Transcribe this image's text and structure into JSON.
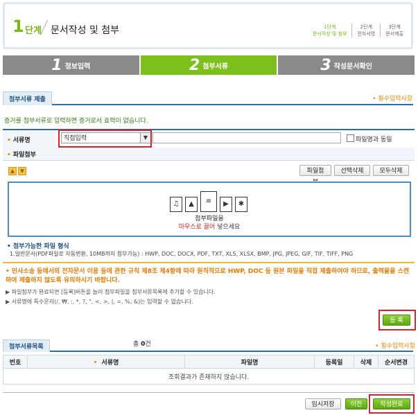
{
  "step_header": {
    "number": "1",
    "word": "단계",
    "title": "문서작성 및 첨부",
    "mini_steps": [
      {
        "label": "1단계",
        "sub": "문서작성 및 첨부"
      },
      {
        "label": "2단계",
        "sub": "전자서명"
      },
      {
        "label": "3단계",
        "sub": "문서제출"
      }
    ]
  },
  "progress_tabs": [
    {
      "num": "1",
      "label": "정보입력"
    },
    {
      "num": "2",
      "label": "첨부서류"
    },
    {
      "num": "3",
      "label": "작성문서확인"
    }
  ],
  "attach_section": {
    "title": "첨부서류 제출",
    "required_note": "필수입력사항",
    "notice": "증거를 첨부서류로 입력하면 증거로서 효력이 없습니다.",
    "doc_name_label": "서류명",
    "select_value": "직접입력",
    "same_as_filename": "파일명과 동일",
    "file_attach_label": "파일첨부",
    "btn_attach": "파일첨부",
    "btn_delete_selected": "선택삭제",
    "btn_delete_all": "모두삭제",
    "drop_text1": "첨부파일을",
    "drop_text2_red": "마우스로 끌어",
    "drop_text2_rest": " 넣으세요",
    "filetype_title": "첨부가능한 파일 형식",
    "filetype_text": "1.일반문서(PDF파일로 자동변환, 10MB까지 첨부가능) : HWP, DOC, DOCX, PDF, TXT, XLS, XLSX, BMP, JPG, JPEG, GIF, TIF, TIFF, PNG",
    "warning": "민사소송 등에서의 전자문서 이용 등에 관한 규칙 제8조 제4항에 따라 원칙적으로 HWP, DOC 등 원본 파일을 직접 제출하여야 하므로, 출력물을 스캔하여 제출하지 않도록 유의하시기 바랍니다.",
    "info1": "파일첨부가 완료되면 [등록]버튼을 눌러 첨부파일을 첨부서류목록에 추가할 수 있습니다.",
    "info2": "서류명에 특수문자(/, ₩, :, *, ?, \", <, >, |, =, %, &)는 입력할 수 없습니다.",
    "register_button": "등 록"
  },
  "list_section": {
    "title": "첨부서류목록",
    "total_prefix": "총 ",
    "total_count": "0",
    "total_suffix": "건",
    "required_note": "필수입력사항",
    "columns": [
      "번호",
      "서류명",
      "파일명",
      "등록일",
      "삭제",
      "순서변경"
    ],
    "empty_message": "조회결과가 존재하지 않습니다."
  },
  "footer": {
    "btn_temp_save": "임시저장",
    "btn_prev": "이전",
    "btn_done": "작성완료"
  },
  "colors": {
    "accent_green": "#7cc01c",
    "highlight_red": "#e01f2b",
    "header_blue": "#2d6da3",
    "warning_orange": "#e57a00"
  }
}
